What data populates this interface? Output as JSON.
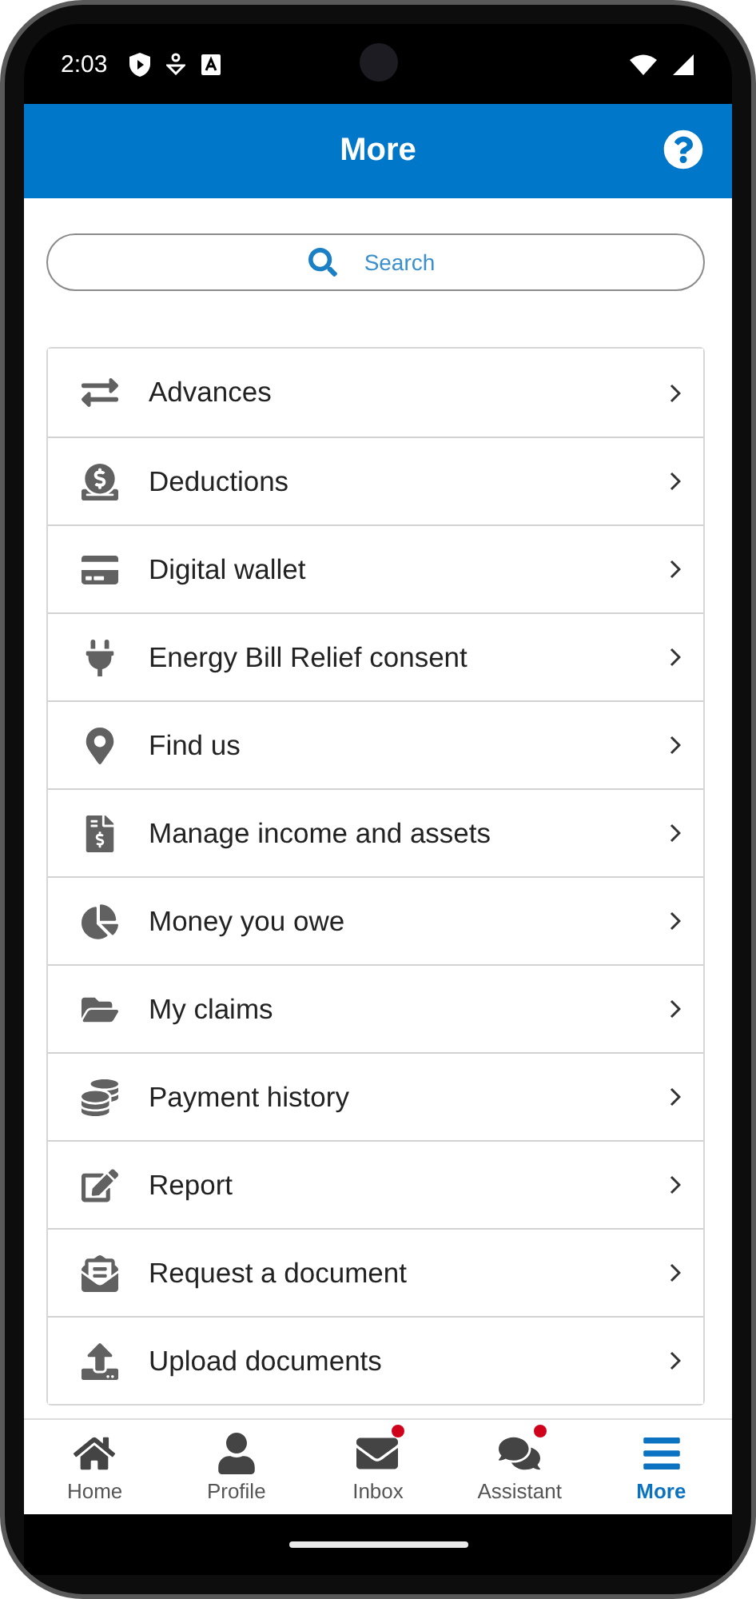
{
  "status_bar": {
    "time": "2:03"
  },
  "app_bar": {
    "title": "More"
  },
  "search": {
    "placeholder": "Search"
  },
  "menu_items": [
    {
      "label": "Advances"
    },
    {
      "label": "Deductions"
    },
    {
      "label": "Digital wallet"
    },
    {
      "label": "Energy Bill Relief consent"
    },
    {
      "label": "Find us"
    },
    {
      "label": "Manage income and assets"
    },
    {
      "label": "Money you owe"
    },
    {
      "label": "My claims"
    },
    {
      "label": "Payment history"
    },
    {
      "label": "Report"
    },
    {
      "label": "Request a document"
    },
    {
      "label": "Upload documents"
    }
  ],
  "bottom_nav": [
    {
      "label": "Home",
      "selected": false,
      "badge": false
    },
    {
      "label": "Profile",
      "selected": false,
      "badge": false
    },
    {
      "label": "Inbox",
      "selected": false,
      "badge": true
    },
    {
      "label": "Assistant",
      "selected": false,
      "badge": true
    },
    {
      "label": "More",
      "selected": true,
      "badge": false
    }
  ]
}
